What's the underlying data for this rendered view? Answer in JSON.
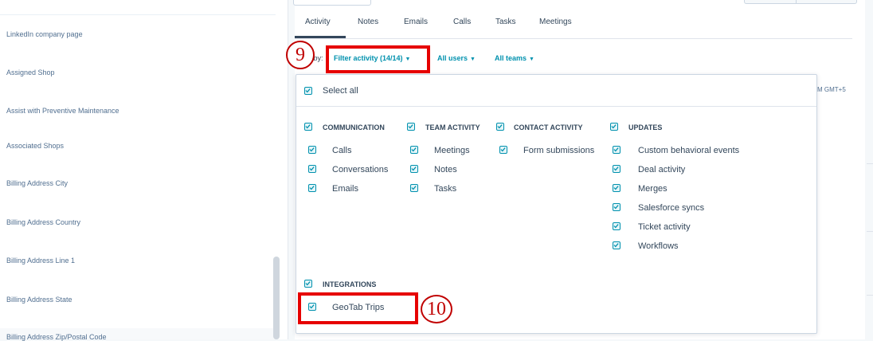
{
  "left_panel": {
    "properties": [
      "LinkedIn company page",
      "Assigned Shop",
      "Assist with Preventive Maintenance",
      "Associated Shops",
      "Billing Address City",
      "Billing Address Country",
      "Billing Address Line 1",
      "Billing Address State",
      "Billing Address Zip/Postal Code"
    ]
  },
  "tabs": [
    "Activity",
    "Notes",
    "Emails",
    "Calls",
    "Tasks",
    "Meetings"
  ],
  "filters": {
    "prefix": "Filter by:",
    "activity": "Filter activity (14/14)",
    "users": "All users",
    "teams": "All teams"
  },
  "right_timestamp": "M GMT+5",
  "dropdown": {
    "select_all": "Select all",
    "groups": [
      {
        "name": "COMMUNICATION",
        "items": [
          "Calls",
          "Conversations",
          "Emails"
        ]
      },
      {
        "name": "TEAM ACTIVITY",
        "items": [
          "Meetings",
          "Notes",
          "Tasks"
        ]
      },
      {
        "name": "CONTACT ACTIVITY",
        "items": [
          "Form submissions"
        ]
      },
      {
        "name": "UPDATES",
        "items": [
          "Custom behavioral events",
          "Deal activity",
          "Merges",
          "Salesforce syncs",
          "Ticket activity",
          "Workflows"
        ]
      },
      {
        "name": "INTEGRATIONS",
        "items": [
          "GeoTab Trips"
        ]
      }
    ]
  },
  "annotations": {
    "step9": "9",
    "step10": "10"
  },
  "colors": {
    "accent": "#0091ae",
    "annotation": "#e60000",
    "text": "#33475b"
  }
}
